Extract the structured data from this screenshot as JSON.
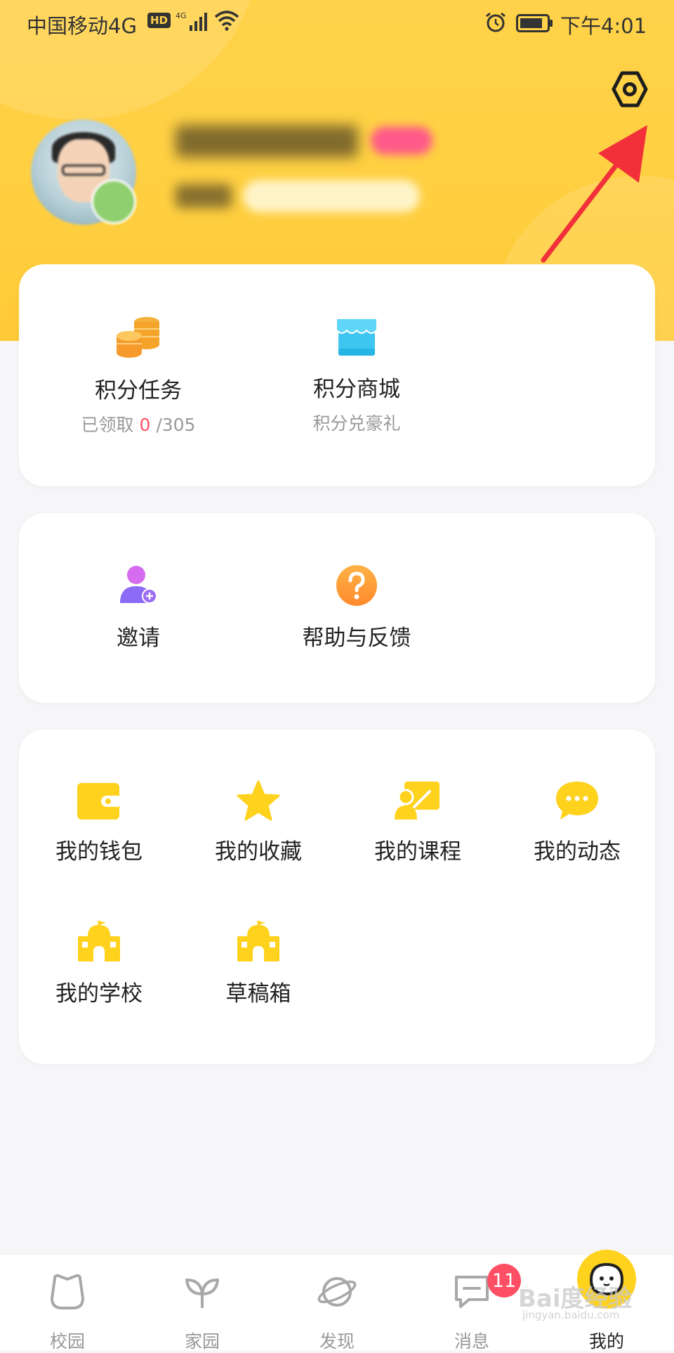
{
  "status_bar": {
    "carrier": "中国移动4G",
    "hd": "HD",
    "time": "下午4:01"
  },
  "colors": {
    "accent": "#ffd21e",
    "header": "#ffcf40",
    "red": "#ff4f64"
  },
  "card_points": {
    "task": {
      "label": "积分任务",
      "sub_prefix": "已领取 ",
      "claimed": "0",
      "sub_suffix": " /305",
      "icon": "coins-icon"
    },
    "mall": {
      "label": "积分商城",
      "sub": "积分兑豪礼",
      "icon": "store-icon"
    }
  },
  "card_social": {
    "invite": {
      "label": "邀请",
      "icon": "invite-user-icon"
    },
    "help": {
      "label": "帮助与反馈",
      "icon": "help-icon"
    }
  },
  "card_grid": {
    "wallet": {
      "label": "我的钱包",
      "icon": "wallet-icon"
    },
    "favorites": {
      "label": "我的收藏",
      "icon": "star-icon"
    },
    "courses": {
      "label": "我的课程",
      "icon": "course-icon"
    },
    "moments": {
      "label": "我的动态",
      "icon": "chat-bubble-icon"
    },
    "school": {
      "label": "我的学校",
      "icon": "school-icon"
    },
    "drafts": {
      "label": "草稿箱",
      "icon": "school-icon"
    }
  },
  "tab_bar": {
    "campus": "校园",
    "home": "家园",
    "discover": "发现",
    "messages": "消息",
    "messages_badge": "11",
    "me": "我的"
  },
  "watermark": {
    "main": "Bai度经验",
    "sub": "jingyan.baidu.com"
  }
}
